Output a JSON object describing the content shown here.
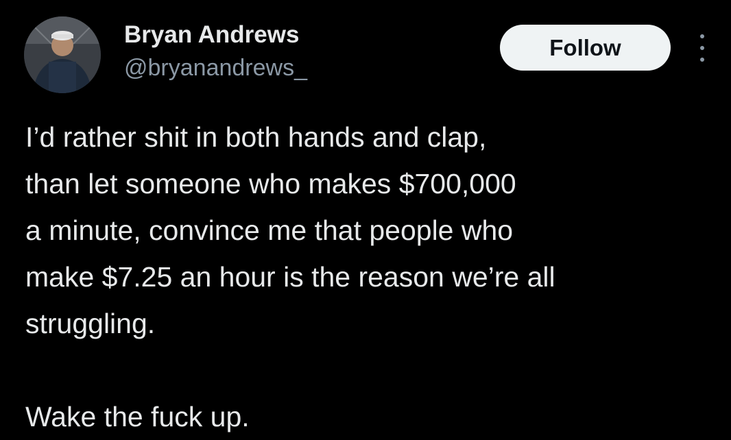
{
  "author": {
    "display_name": "Bryan Andrews",
    "handle": "@bryanandrews_",
    "avatar_icon": "profile-photo"
  },
  "actions": {
    "follow_label": "Follow",
    "more_icon": "more-options-icon"
  },
  "tweet": {
    "lines": [
      "I’d rather shit in both hands and clap,",
      "than let someone who makes $700,000",
      "a minute, convince me that people who",
      "make $7.25 an hour is the reason we’re all",
      "struggling.",
      "",
      "Wake the fuck up."
    ]
  },
  "colors": {
    "background": "#000000",
    "text_primary": "#e7e9ea",
    "text_secondary": "#8b98a5",
    "follow_bg": "#eff3f4",
    "follow_text": "#0f1419"
  }
}
